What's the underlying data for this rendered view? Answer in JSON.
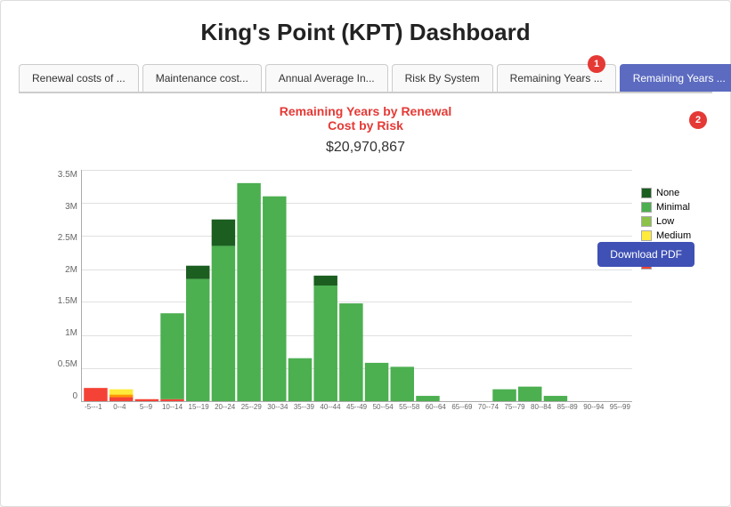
{
  "title": "King's Point (KPT) Dashboard",
  "tabs": [
    {
      "label": "Renewal costs of ...",
      "active": false
    },
    {
      "label": "Maintenance cost...",
      "active": false
    },
    {
      "label": "Annual Average In...",
      "active": false
    },
    {
      "label": "Risk By System",
      "active": false
    },
    {
      "label": "Remaining Years ...",
      "active": false
    },
    {
      "label": "Remaining Years ...",
      "active": true
    }
  ],
  "badge1": "1",
  "badge2": "2",
  "download_label": "Download PDF",
  "chart": {
    "title_line1": "Remaining Years by Renewal",
    "title_line2": "Cost by Risk",
    "total": "$20,970,867"
  },
  "y_axis": [
    "3.5M",
    "3M",
    "2.5M",
    "2M",
    "1.5M",
    "1M",
    "0.5M",
    "0"
  ],
  "x_labels": [
    "-5--1",
    "0-4",
    "5-9",
    "10-14",
    "15-19",
    "20-24",
    "25-29",
    "30-34",
    "35-39",
    "40-44",
    "45-49",
    "50-54",
    "55-58",
    "60-64",
    "65-69",
    "70-74",
    "75-79",
    "80-84",
    "85-89",
    "90-94",
    "95-99"
  ],
  "legend": [
    {
      "label": "None",
      "color": "#1b5e20"
    },
    {
      "label": "Minimal",
      "color": "#4caf50"
    },
    {
      "label": "Low",
      "color": "#8bc34a"
    },
    {
      "label": "Medium",
      "color": "#ffeb3b"
    },
    {
      "label": "High",
      "color": "#ff9800"
    },
    {
      "label": "Extreme",
      "color": "#f44336"
    }
  ],
  "bars": [
    {
      "x": "-5--1",
      "none": 0,
      "minimal": 0,
      "low": 0,
      "medium": 0,
      "high": 0,
      "extreme": 45
    },
    {
      "x": "0-4",
      "none": 0,
      "minimal": 0,
      "low": 0,
      "medium": 10,
      "high": 5,
      "extreme": 8
    },
    {
      "x": "5-9",
      "none": 0,
      "minimal": 0,
      "low": 0,
      "medium": 0,
      "high": 0,
      "extreme": 5
    },
    {
      "x": "10-14",
      "none": 0,
      "minimal": 130,
      "low": 0,
      "medium": 0,
      "high": 0,
      "extreme": 5
    },
    {
      "x": "15-19",
      "none": 20,
      "minimal": 185,
      "low": 0,
      "medium": 0,
      "high": 0,
      "extreme": 0
    },
    {
      "x": "20-24",
      "none": 40,
      "minimal": 235,
      "low": 0,
      "medium": 0,
      "high": 0,
      "extreme": 0
    },
    {
      "x": "25-29",
      "none": 0,
      "minimal": 330,
      "low": 0,
      "medium": 0,
      "high": 0,
      "extreme": 0
    },
    {
      "x": "30-34",
      "none": 0,
      "minimal": 310,
      "low": 0,
      "medium": 0,
      "high": 0,
      "extreme": 0
    },
    {
      "x": "35-39",
      "none": 0,
      "minimal": 65,
      "low": 0,
      "medium": 0,
      "high": 0,
      "extreme": 0
    },
    {
      "x": "40-44",
      "none": 15,
      "minimal": 175,
      "low": 0,
      "medium": 0,
      "high": 0,
      "extreme": 0
    },
    {
      "x": "45-49",
      "none": 0,
      "minimal": 148,
      "low": 0,
      "medium": 0,
      "high": 0,
      "extreme": 0
    },
    {
      "x": "50-54",
      "none": 0,
      "minimal": 58,
      "low": 0,
      "medium": 0,
      "high": 0,
      "extreme": 0
    },
    {
      "x": "55-58",
      "none": 0,
      "minimal": 52,
      "low": 0,
      "medium": 0,
      "high": 0,
      "extreme": 0
    },
    {
      "x": "60-64",
      "none": 0,
      "minimal": 8,
      "low": 0,
      "medium": 0,
      "high": 0,
      "extreme": 0
    },
    {
      "x": "65-69",
      "none": 0,
      "minimal": 0,
      "low": 0,
      "medium": 0,
      "high": 0,
      "extreme": 0
    },
    {
      "x": "70-74",
      "none": 0,
      "minimal": 0,
      "low": 0,
      "medium": 0,
      "high": 0,
      "extreme": 0
    },
    {
      "x": "75-79",
      "none": 0,
      "minimal": 18,
      "low": 0,
      "medium": 0,
      "high": 0,
      "extreme": 0
    },
    {
      "x": "80-84",
      "none": 0,
      "minimal": 22,
      "low": 0,
      "medium": 0,
      "high": 0,
      "extreme": 0
    },
    {
      "x": "85-89",
      "none": 0,
      "minimal": 8,
      "low": 0,
      "medium": 0,
      "high": 0,
      "extreme": 0
    },
    {
      "x": "90-94",
      "none": 0,
      "minimal": 0,
      "low": 0,
      "medium": 0,
      "high": 0,
      "extreme": 0
    },
    {
      "x": "95-99",
      "none": 0,
      "minimal": 0,
      "low": 0,
      "medium": 0,
      "high": 0,
      "extreme": 0
    }
  ]
}
